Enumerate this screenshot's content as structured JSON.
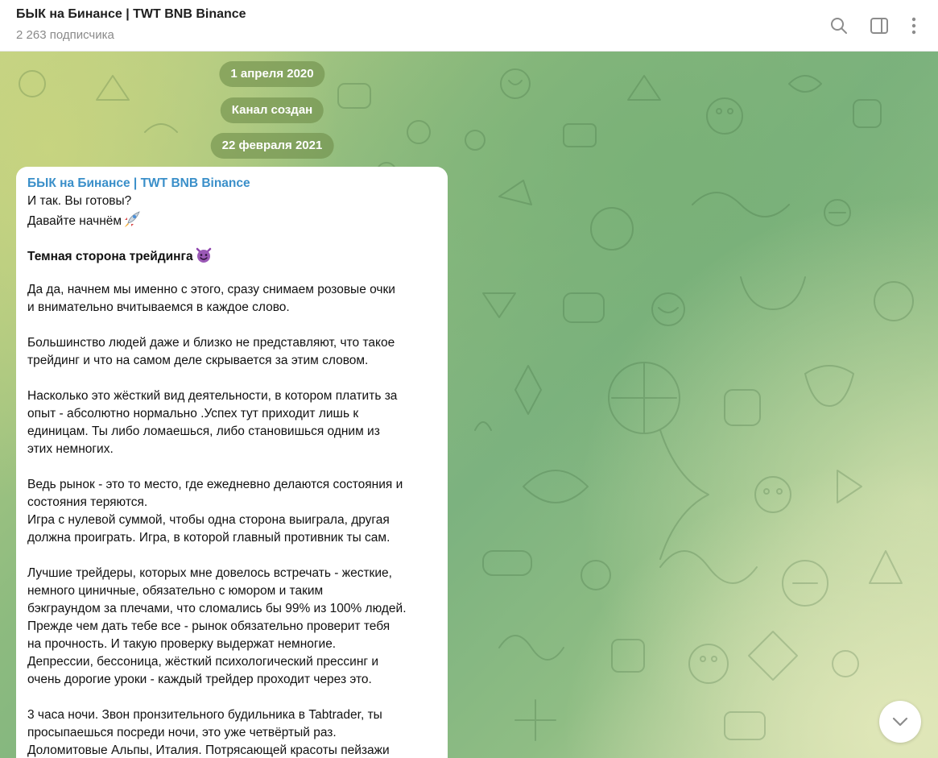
{
  "header": {
    "title": "БЫК на Бинансе | TWT BNB Binance",
    "subscribers": "2 263 подписчика"
  },
  "service": {
    "date1": "1 апреля 2020",
    "created": "Канал создан",
    "date2": "22 февраля 2021"
  },
  "message": {
    "author": "БЫК на Бинансе | TWT BNB Binance",
    "l1": "И так. Вы готовы?",
    "l2": "Давайте начнём",
    "heading": "Темная сторона трейдинга",
    "p1a": "Да да, начнем мы именно с этого, сразу снимаем розовые очки",
    "p1b": "и внимательно вчитываемся в каждое слово.",
    "p2a": "Большинство людей даже и близко не представляют, что такое",
    "p2b": "трейдинг и что на самом деле скрывается за этим словом.",
    "p3a": "Насколько это жёсткий вид деятельности, в котором платить за",
    "p3b": "опыт - абсолютно нормально .Успех тут приходит лишь к",
    "p3c": "единицам. Ты либо ломаешься, либо становишься одним из",
    "p3d": "этих немногих.",
    "p4a": "Ведь рынок - это то место, где ежедневно делаются состояния и",
    "p4b": "состояния теряются.",
    "p4c": "Игра с нулевой суммой, чтобы одна сторона выиграла, другая",
    "p4d": "должна проиграть. Игра, в которой главный противник ты сам.",
    "p5a": "Лучшие трейдеры, которых мне довелось встречать - жесткие,",
    "p5b": "немного циничные, обязательно с юмором и таким",
    "p5c": "бэкграундом за плечами, что сломались бы 99% из 100% людей.",
    "p5d": "Прежде чем дать тебе все - рынок обязательно проверит тебя",
    "p5e": "на прочность. И такую проверку выдержат немногие.",
    "p5f": "Депрессии, бессоница, жёсткий психологический прессинг и",
    "p5g": "очень дорогие уроки - каждый трейдер проходит через это.",
    "p6a": "3 часа ночи. Звон пронзительного будильника в Tabtrader, ты",
    "p6b": "просыпаешься посреди ночи, это уже четвёртый раз.",
    "p6c": "Доломитовые Альпы, Италия. Потрясающей красоты пейзажи"
  },
  "icons": {
    "search": "search-icon",
    "sidebar": "sidebar-toggle-icon",
    "menu": "more-vertical-icon",
    "rocket": "rocket-emoji-icon",
    "devil": "smiling-devil-emoji-icon",
    "scroll": "chevron-down-icon"
  },
  "colors": {
    "author": "#3a8fc9",
    "chip_bg": "#6f8e4a",
    "header_title": "#1f1f1f",
    "header_subtitle": "#8a8a8a"
  }
}
